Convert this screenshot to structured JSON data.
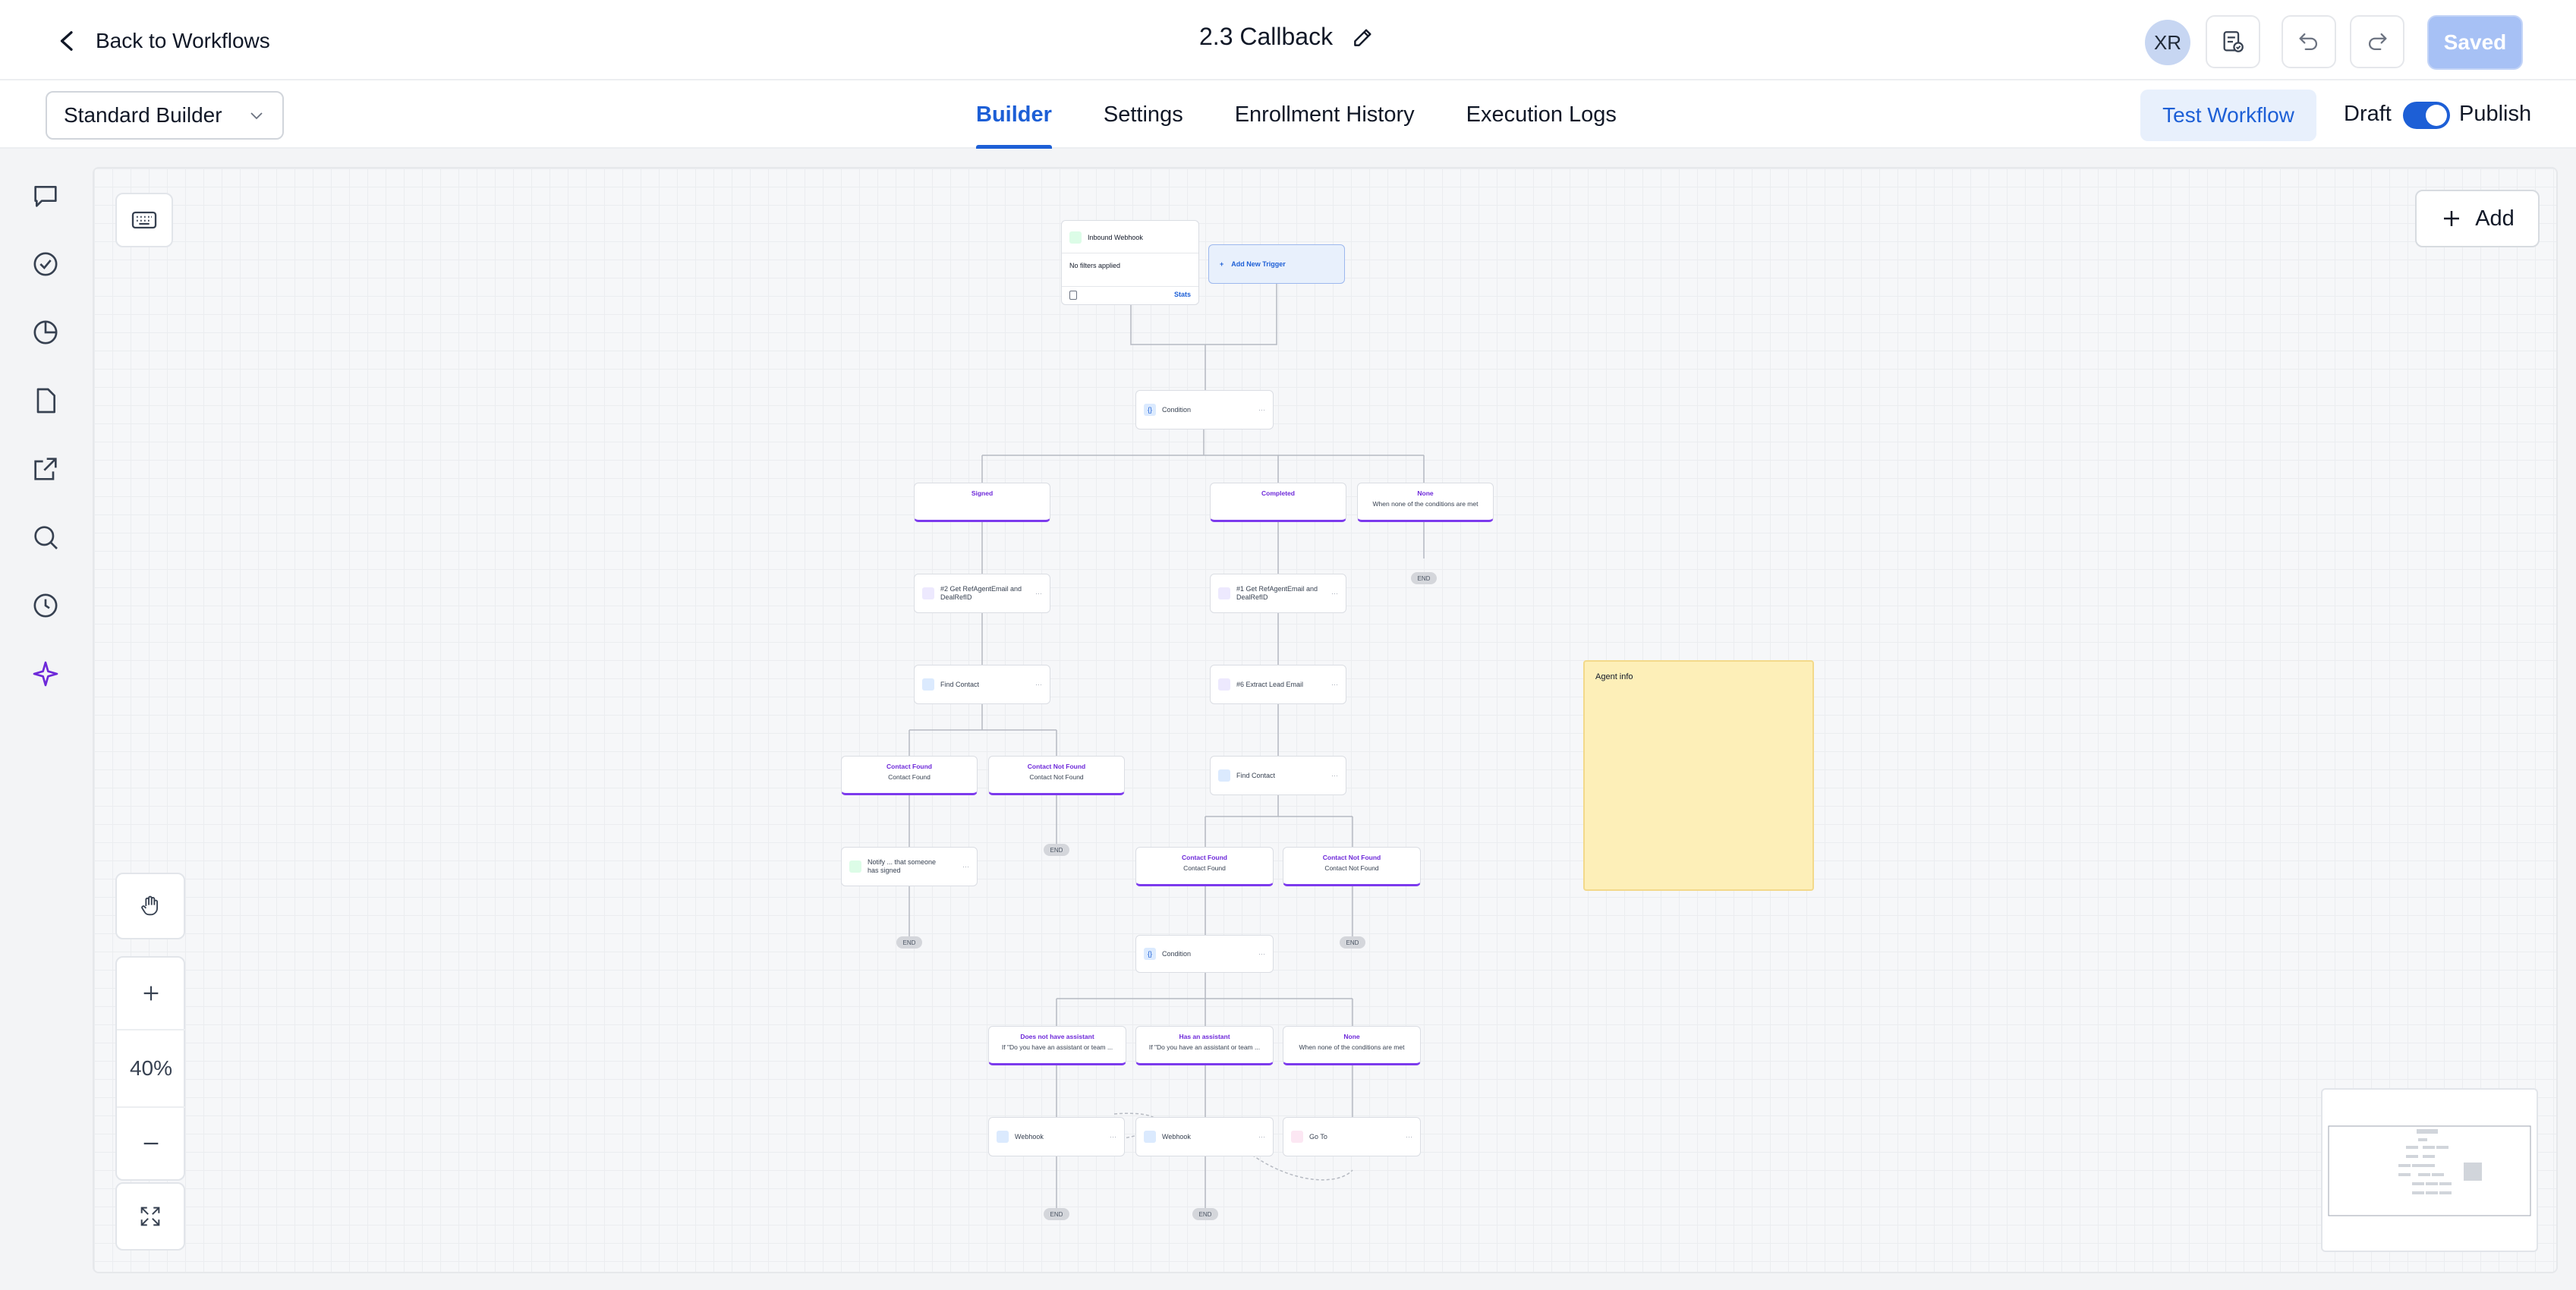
{
  "header": {
    "back_label": "Back to Workflows",
    "title": "2.3 Callback",
    "avatar_initials": "XR",
    "saved_label": "Saved"
  },
  "subbar": {
    "builder_select": "Standard Builder",
    "tabs": [
      {
        "label": "Builder",
        "active": true
      },
      {
        "label": "Settings",
        "active": false
      },
      {
        "label": "Enrollment History",
        "active": false
      },
      {
        "label": "Execution Logs",
        "active": false
      }
    ],
    "test_workflow_label": "Test Workflow",
    "draft_label": "Draft",
    "publish_label": "Publish",
    "publish_toggle_on": true
  },
  "rail_icons": [
    "chat-icon",
    "check-circle-icon",
    "pie-chart-icon",
    "document-icon",
    "external-link-icon",
    "search-icon",
    "history-icon",
    "sparkle-icon"
  ],
  "canvas": {
    "add_label": "Add",
    "zoom_level": "40%",
    "sticky_note": "Agent info",
    "trigger": {
      "title": "Inbound Webhook",
      "filters": "No filters applied",
      "stats_label": "Stats"
    },
    "add_trigger_label": "Add New Trigger",
    "nodes": {
      "condition_1": "Condition",
      "branch_signed": "Signed",
      "branch_completed": "Completed",
      "branch_none_1": {
        "title": "None",
        "sub": "When none of the conditions are met"
      },
      "get_ref_2": "#2 Get RefAgentEmail and DealRefID",
      "get_ref_1": "#1 Get RefAgentEmail and DealRefID",
      "find_contact_1": "Find Contact",
      "extract_lead": "#6 Extract Lead Email",
      "find_contact_2": "Find Contact",
      "contact_found_1": {
        "title": "Contact Found",
        "sub": "Contact Found"
      },
      "contact_not_found_1": {
        "title": "Contact Not Found",
        "sub": "Contact Not Found"
      },
      "contact_found_2": {
        "title": "Contact Found",
        "sub": "Contact Found"
      },
      "contact_not_found_2": {
        "title": "Contact Not Found",
        "sub": "Contact Not Found"
      },
      "notify": "Notify ... that someone has signed",
      "condition_2": "Condition",
      "branch_no_assistant": {
        "title": "Does not have assistant",
        "sub": "If \"Do you have an assistant or team ..."
      },
      "branch_has_assistant": {
        "title": "Has an assistant",
        "sub": "If \"Do you have an assistant or team ..."
      },
      "branch_none_2": {
        "title": "None",
        "sub": "When none of the conditions are met"
      },
      "webhook_1": "Webhook",
      "webhook_2": "Webhook",
      "goto": "Go To",
      "end_label": "END"
    }
  }
}
